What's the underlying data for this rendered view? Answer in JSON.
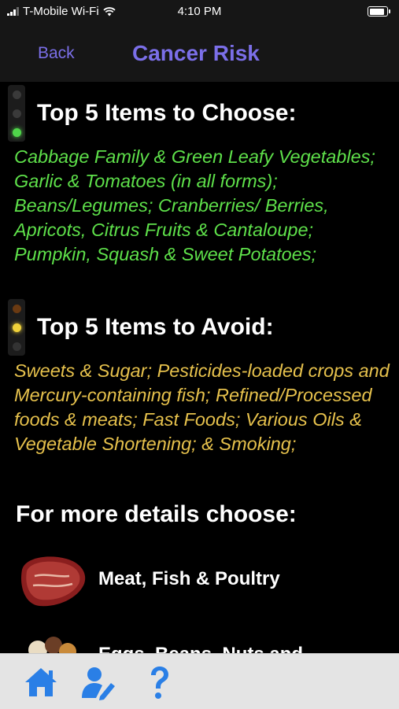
{
  "status_bar": {
    "carrier": "T-Mobile Wi-Fi",
    "time": "4:10 PM"
  },
  "nav": {
    "back_label": "Back",
    "title": "Cancer Risk"
  },
  "choose": {
    "title": "Top 5 Items to Choose:",
    "text": "Cabbage Family & Green Leafy Vegetables; Garlic & Tomatoes (in all forms); Beans/Legumes; Cranberries/ Berries, Apricots, Citrus Fruits & Cantaloupe; Pumpkin, Squash & Sweet Potatoes;"
  },
  "avoid": {
    "title": "Top 5 Items to Avoid:",
    "text": "Sweets & Sugar; Pesticides-loaded crops and Mercury-containing fish; Refined/Processed foods & meats; Fast Foods; Various Oils & Vegetable Shortening; & Smoking;"
  },
  "details": {
    "heading": "For more details choose:",
    "items": [
      {
        "label": "Meat, Fish & Poultry"
      },
      {
        "label": "Eggs, Beans, Nuts and"
      }
    ]
  },
  "tab_bar": {
    "icons": [
      "home-icon",
      "user-edit-icon",
      "help-icon"
    ],
    "accent": "#2a7fe6"
  },
  "colors": {
    "choose_text": "#5ee04a",
    "avoid_text": "#e6c14c",
    "nav_accent": "#7b6fe8"
  }
}
